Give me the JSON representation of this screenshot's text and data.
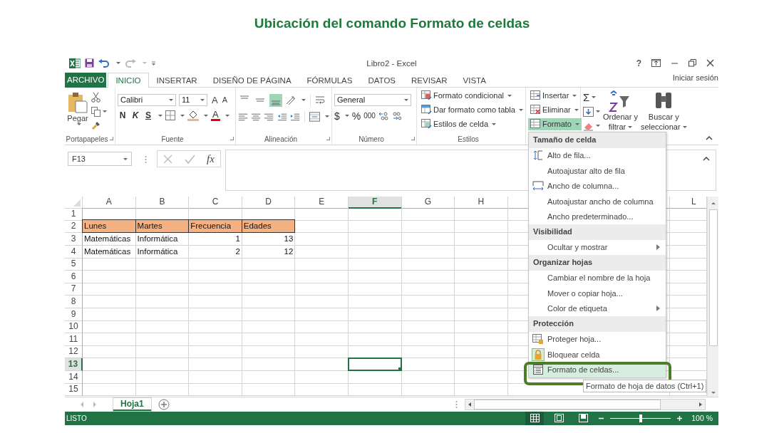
{
  "page_title": "Ubicación del comando Formato de celdas",
  "window": {
    "title": "Libro2 - Excel",
    "help": "?"
  },
  "tabs": [
    {
      "label": "ARCHIVO",
      "kind": "file",
      "selected": false
    },
    {
      "label": "INICIO",
      "kind": "tab",
      "selected": true
    },
    {
      "label": "INSERTAR",
      "kind": "tab",
      "selected": false
    },
    {
      "label": "DISEÑO DE PÁGINA",
      "kind": "tab",
      "selected": false
    },
    {
      "label": "FÓRMULAS",
      "kind": "tab",
      "selected": false
    },
    {
      "label": "DATOS",
      "kind": "tab",
      "selected": false
    },
    {
      "label": "REVISAR",
      "kind": "tab",
      "selected": false
    },
    {
      "label": "VISTA",
      "kind": "tab",
      "selected": false
    }
  ],
  "sign_in": "Iniciar sesión",
  "ribbon": {
    "clipboard": {
      "paste": "Pegar",
      "label": "Portapapeles"
    },
    "font": {
      "name": "Calibri",
      "size": "11",
      "grow": "A",
      "shrink": "A",
      "bold": "N",
      "italic": "K",
      "underline": "S",
      "font_color": "A",
      "label": "Fuente"
    },
    "alignment": {
      "vertical": [
        {
          "selected": false
        },
        {
          "selected": false
        },
        {
          "selected": true
        }
      ],
      "label": "Alineación"
    },
    "number": {
      "format": "General",
      "currency": "$",
      "percent": "%",
      "thousands": "000",
      "label": "Número"
    },
    "styles": {
      "commands": [
        "Formato condicional",
        "Dar formato como tabla",
        "Estilos de celda"
      ],
      "label": "Estilos"
    },
    "cells": {
      "commands": [
        {
          "label": "Insertar",
          "selected": false
        },
        {
          "label": "Eliminar",
          "selected": false
        },
        {
          "label": "Formato",
          "selected": true
        }
      ]
    },
    "editing": {
      "sum": "Σ",
      "sort": [
        "Ordenar y",
        "filtrar"
      ],
      "find": [
        "Buscar y",
        "seleccionar"
      ]
    }
  },
  "formula_bar": {
    "name_box": "F13",
    "fx": "fx"
  },
  "sheet": {
    "columns": [
      {
        "label": "A",
        "selected": false
      },
      {
        "label": "B",
        "selected": false
      },
      {
        "label": "C",
        "selected": false
      },
      {
        "label": "D",
        "selected": false
      },
      {
        "label": "E",
        "selected": false
      },
      {
        "label": "F",
        "selected": true
      },
      {
        "label": "G",
        "selected": false
      },
      {
        "label": "H",
        "selected": false
      },
      {
        "label": "L",
        "selected": false
      }
    ],
    "rows": [
      {
        "label": "1",
        "selected": false
      },
      {
        "label": "2",
        "selected": false,
        "cells": [
          {
            "kind": "header",
            "text": "Lunes"
          },
          {
            "kind": "header",
            "text": "Martes"
          },
          {
            "kind": "header",
            "text": "Frecuencia"
          },
          {
            "kind": "header",
            "text": "Edades"
          }
        ]
      },
      {
        "label": "3",
        "selected": false,
        "cells": [
          {
            "kind": "text",
            "text": "Matemáticas"
          },
          {
            "kind": "text",
            "text": "Informática"
          },
          {
            "kind": "number",
            "text": "1"
          },
          {
            "kind": "number",
            "text": "13"
          }
        ]
      },
      {
        "label": "4",
        "selected": false,
        "cells": [
          {
            "kind": "text",
            "text": "Matemáticas"
          },
          {
            "kind": "text",
            "text": "Informática"
          },
          {
            "kind": "number",
            "text": "2"
          },
          {
            "kind": "number",
            "text": "12"
          }
        ]
      },
      {
        "label": "5",
        "selected": false
      },
      {
        "label": "6",
        "selected": false
      },
      {
        "label": "7",
        "selected": false
      },
      {
        "label": "8",
        "selected": false
      },
      {
        "label": "9",
        "selected": false
      },
      {
        "label": "10",
        "selected": false
      },
      {
        "label": "11",
        "selected": false
      },
      {
        "label": "12",
        "selected": false
      },
      {
        "label": "13",
        "selected": true
      },
      {
        "label": "14",
        "selected": false
      },
      {
        "label": "15",
        "selected": false
      }
    ]
  },
  "sheet_tabs": [
    {
      "label": "Hoja1",
      "selected": true
    }
  ],
  "status_bar": {
    "text": "LISTO",
    "views": [
      {
        "selected": true
      },
      {
        "selected": false
      },
      {
        "selected": false
      }
    ],
    "zoom": {
      "level": 0.5,
      "reading": "100 %"
    }
  },
  "menu": {
    "sections": [
      {
        "title": "Tamaño de celda",
        "items": [
          {
            "label": "Alto de fila...",
            "submenu": false,
            "selected": false
          },
          {
            "label": "Autoajustar alto de fila",
            "submenu": false,
            "selected": false
          },
          {
            "label": "Ancho de columna...",
            "submenu": false,
            "selected": false
          },
          {
            "label": "Autoajustar ancho de columna",
            "submenu": false,
            "selected": false
          },
          {
            "label": "Ancho predeterminado...",
            "submenu": false,
            "selected": false
          }
        ]
      },
      {
        "title": "Visibilidad",
        "items": [
          {
            "label": "Ocultar y mostrar",
            "submenu": true,
            "selected": false
          }
        ]
      },
      {
        "title": "Organizar hojas",
        "items": [
          {
            "label": "Cambiar el nombre de la hoja",
            "submenu": false,
            "selected": false
          },
          {
            "label": "Mover o copiar hoja...",
            "submenu": false,
            "selected": false
          },
          {
            "label": "Color de etiqueta",
            "submenu": true,
            "selected": false
          }
        ]
      },
      {
        "title": "Protección",
        "items": [
          {
            "label": "Proteger hoja...",
            "submenu": false,
            "selected": false
          },
          {
            "label": "Bloquear celda",
            "submenu": false,
            "selected": false
          },
          {
            "label": "Formato de celdas...",
            "submenu": false,
            "selected": true
          }
        ]
      }
    ]
  },
  "tooltip": "Formato de hoja de datos (Ctrl+1)"
}
